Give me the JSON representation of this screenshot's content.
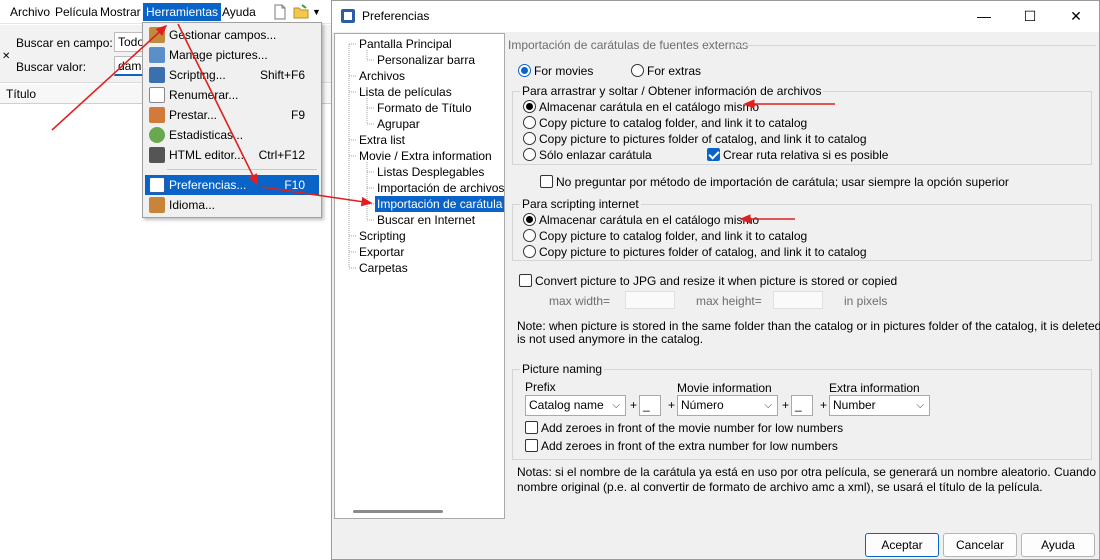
{
  "main_window": {
    "menus": [
      "Archivo",
      "Película",
      "Mostrar",
      "Herramientas",
      "Ayuda"
    ],
    "search": {
      "field_label": "Buscar en campo:",
      "field_value": "Todo",
      "value_label": "Buscar valor:",
      "value_text": "dama"
    },
    "list_header": "Título"
  },
  "tools_menu": {
    "items": [
      {
        "label": "Gestionar campos...",
        "shortcut": "",
        "icon": "fields-icon",
        "color": "#c28a3c"
      },
      {
        "label": "Manage pictures...",
        "shortcut": "",
        "icon": "picture-icon",
        "color": "#5a8fc8"
      },
      {
        "label": "Scripting...",
        "shortcut": "Shift+F6",
        "icon": "script-icon",
        "color": "#3a6fb0"
      },
      {
        "label": "Renumerar...",
        "shortcut": "",
        "icon": "renumber-icon",
        "color": "#666666"
      },
      {
        "label": "Prestar...",
        "shortcut": "F9",
        "icon": "people-icon",
        "color": "#d27a3a"
      },
      {
        "label": "Estadisticas...",
        "shortcut": "",
        "icon": "stats-icon",
        "color": "#6aa84f"
      },
      {
        "label": "HTML editor...",
        "shortcut": "Ctrl+F12",
        "icon": "html-editor-icon",
        "color": "#555555"
      },
      {
        "label": "Preferencias...",
        "shortcut": "F10",
        "icon": "preferences-icon",
        "color": "#2a5fa8"
      },
      {
        "label": "Idioma...",
        "shortcut": "",
        "icon": "language-icon",
        "color": "#c8853a"
      }
    ]
  },
  "dialog": {
    "title": "Preferencias",
    "tree": [
      {
        "label": "Pantalla Principal",
        "level": 0
      },
      {
        "label": "Personalizar barra",
        "level": 1
      },
      {
        "label": "Archivos",
        "level": 0
      },
      {
        "label": "Lista de películas",
        "level": 0
      },
      {
        "label": "Formato de Título",
        "level": 1
      },
      {
        "label": "Agrupar",
        "level": 1
      },
      {
        "label": "Extra list",
        "level": 0
      },
      {
        "label": "Movie / Extra information",
        "level": 0
      },
      {
        "label": "Listas Desplegables",
        "level": 1
      },
      {
        "label": "Importación de archivos de",
        "level": 1
      },
      {
        "label": "Importación de carátula",
        "level": 1,
        "selected": true
      },
      {
        "label": "Buscar en Internet",
        "level": 1
      },
      {
        "label": "Scripting",
        "level": 0
      },
      {
        "label": "Exportar",
        "level": 0
      },
      {
        "label": "Carpetas",
        "level": 0
      }
    ],
    "panel": {
      "section_title": "Importación de carátulas de fuentes externas",
      "for_movies": "For movies",
      "for_extras": "For extras",
      "drag_group": {
        "title": "Para arrastrar y soltar / Obtener información de archivos",
        "options": [
          "Almacenar carátula en el catálogo mismo",
          "Copy picture to catalog folder, and link it to catalog",
          "Copy picture to pictures folder of catalog, and link it to catalog",
          "Sólo enlazar carátula"
        ],
        "relative_path": "Crear ruta relativa si es posible"
      },
      "no_ask": "No preguntar por método de importación de carátula; usar siempre la opción superior",
      "script_group": {
        "title": "Para scripting internet",
        "options": [
          "Almacenar carátula en el catálogo mismo",
          "Copy picture to catalog folder, and link it to catalog",
          "Copy picture to pictures folder of catalog, and link it to catalog"
        ]
      },
      "convert_jpg": "Convert picture to JPG and resize it when picture is stored or copied",
      "max_width": "max width=",
      "max_height": "max height=",
      "in_pixels": "in pixels",
      "note1": "Note: when picture is stored in the same folder than the catalog or in pictures folder of the catalog, it is deleted when it",
      "note2": "is not used anymore in the catalog.",
      "naming": {
        "title": "Picture naming",
        "prefix_label": "Prefix",
        "movie_info_label": "Movie information",
        "extra_info_label": "Extra information",
        "prefix_value": "Catalog name",
        "sep1": "_",
        "movie_value": "Número",
        "sep2": "_",
        "extra_value": "Number",
        "plus": "+",
        "zeroes_movie": "Add zeroes in front of the movie number for low numbers",
        "zeroes_extra": "Add zeroes in front of the extra number for low numbers"
      },
      "notes1": "Notas: si el nombre de la carátula ya está en uso por otra película, se generará un nombre aleatorio. Cuando no exista",
      "notes2": "nombre original (p.e. al convertir de formato de archivo amc a xml), se usará el título de la película."
    },
    "buttons": {
      "accept": "Aceptar",
      "cancel": "Cancelar",
      "help": "Ayuda"
    }
  },
  "annotation_color": "#e02020"
}
